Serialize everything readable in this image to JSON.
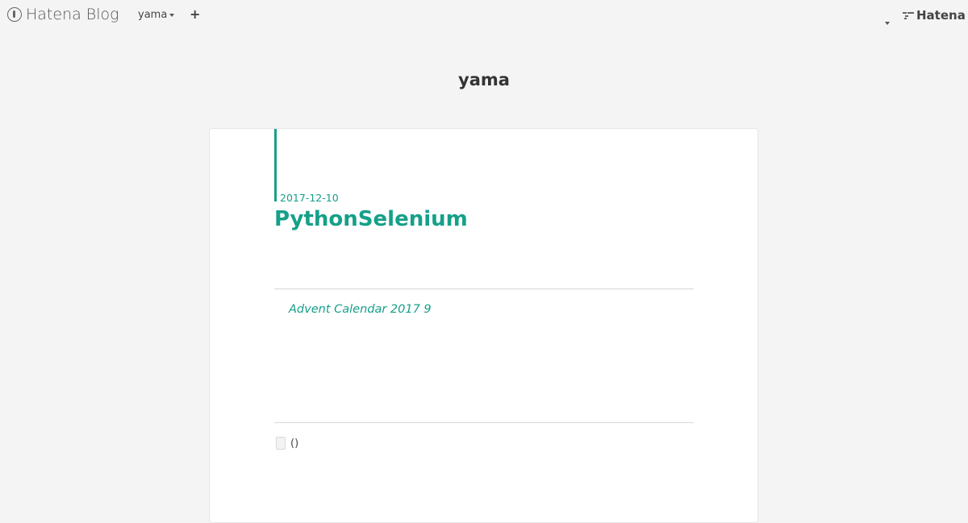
{
  "header": {
    "logo_text": "Hatena Blog",
    "user_name": "yama",
    "add_label": "+",
    "hatena_label": "Hatena"
  },
  "blog": {
    "title": "yama"
  },
  "entry": {
    "date": "2017-12-10",
    "title": "PythonSelenium",
    "content": "Advent Calendar 2017 9",
    "category_text": "()"
  },
  "colors": {
    "accent": "#16a089",
    "background": "#f4f4f4",
    "card": "#ffffff"
  }
}
